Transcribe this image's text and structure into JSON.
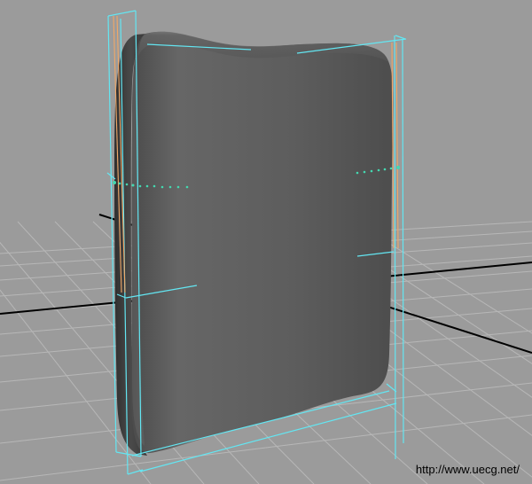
{
  "viewport": {
    "background_color": "#9b9b9b",
    "grid_color": "#b9b9b9",
    "axis_color": "#000000",
    "object_color": "#5a5a5a",
    "selection_color": "#63e6f2",
    "pivot_color": "#f0a868",
    "cv_color": "#44d8b0",
    "watermark": "http://www.uecg.net/"
  }
}
